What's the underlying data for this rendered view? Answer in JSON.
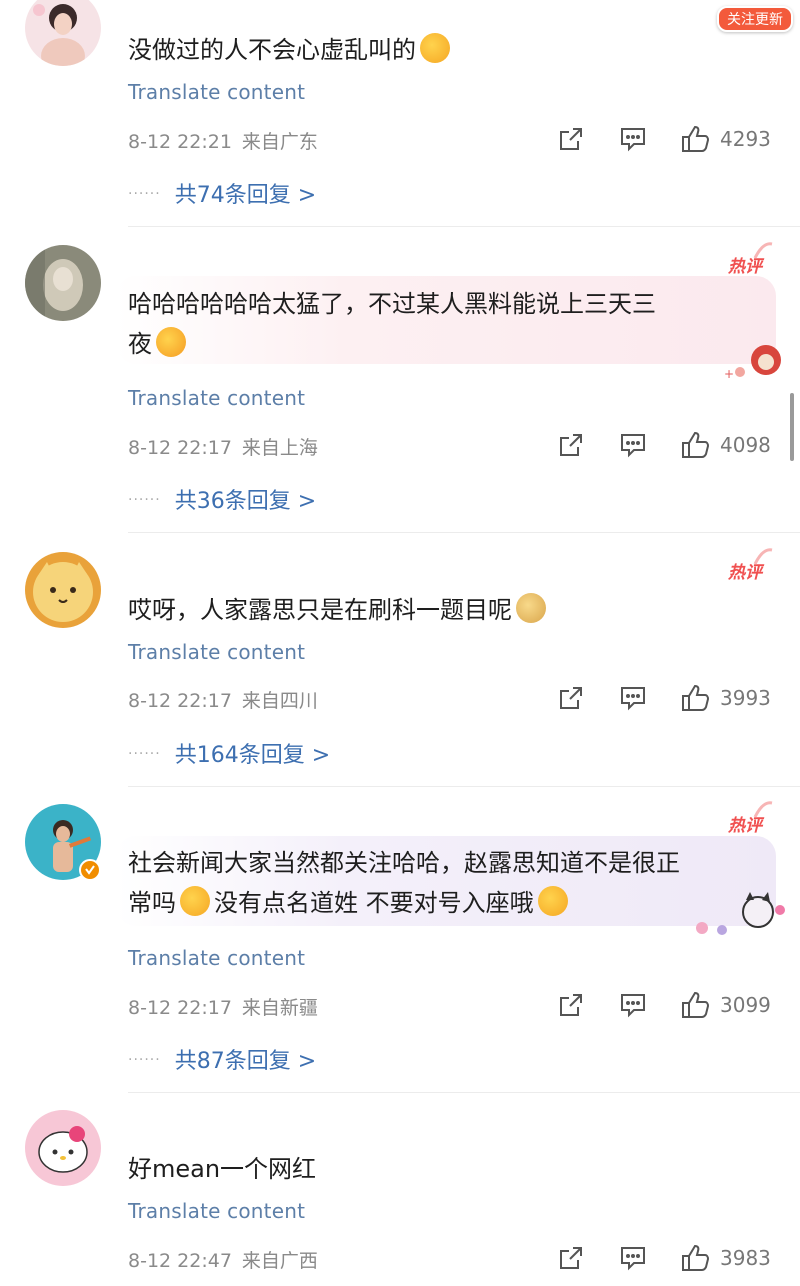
{
  "follow_badge": "关注更新",
  "translate_label": "Translate content",
  "hot_label": "热评",
  "comments": [
    {
      "text": "没做过的人不会心虚乱叫的",
      "time": "8-12 22:21",
      "location": "来自广东",
      "likes": "4293",
      "replies": "共74条回复 >"
    },
    {
      "text_line1": "哈哈哈哈哈哈太猛了，不过某人黑料能说上三天三",
      "text_line2": "夜",
      "time": "8-12 22:17",
      "location": "来自上海",
      "likes": "4098",
      "replies": "共36条回复 >"
    },
    {
      "text": "哎呀，人家露思只是在刷科一题目呢",
      "time": "8-12 22:17",
      "location": "来自四川",
      "likes": "3993",
      "replies": "共164条回复 >"
    },
    {
      "text_line1": "社会新闻大家当然都关注哈哈，赵露思知道不是很正",
      "text_line2a": "常吗",
      "text_line2b": "没有点名道姓 不要对号入座哦",
      "time": "8-12 22:17",
      "location": "来自新疆",
      "likes": "3099",
      "replies": "共87条回复 >"
    },
    {
      "text": "好mean一个网红",
      "time": "8-12 22:47",
      "location": "来自广西",
      "likes": "3983"
    }
  ],
  "colors": {
    "link": "#3d6fb0",
    "translate": "#5d7fa8",
    "hot": "#f05050",
    "meta": "#8a8a8a"
  },
  "icons": [
    "share-icon",
    "comment-icon",
    "like-icon",
    "verified-badge-icon"
  ]
}
